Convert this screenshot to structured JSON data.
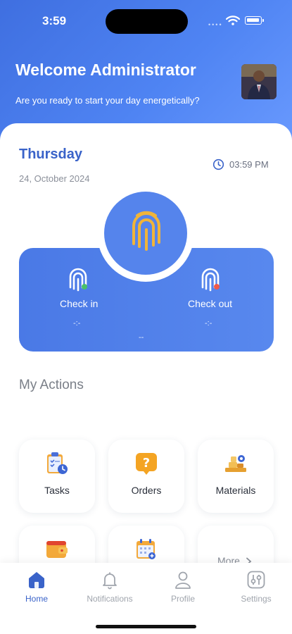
{
  "status_bar": {
    "time": "3:59"
  },
  "header": {
    "welcome": "Welcome Administrator",
    "subtitle": "Are you ready to start your day energetically?"
  },
  "attendance": {
    "day": "Thursday",
    "date": "24, October 2024",
    "current_time": "03:59 PM",
    "check_in": {
      "label": "Check in",
      "value": "-:-"
    },
    "check_out": {
      "label": "Check out",
      "value": "-:-"
    },
    "total": "--"
  },
  "actions": {
    "title": "My Actions",
    "tiles": [
      {
        "label": "Tasks",
        "icon": "tasks-icon"
      },
      {
        "label": "Orders",
        "icon": "orders-icon"
      },
      {
        "label": "Materials",
        "icon": "materials-icon"
      },
      {
        "label": "",
        "icon": "wallet-icon"
      },
      {
        "label": "",
        "icon": "calendar-icon"
      },
      {
        "label": "More",
        "icon": "chevron-right-icon"
      }
    ]
  },
  "nav": {
    "items": [
      {
        "label": "Home",
        "icon": "home-icon",
        "active": true
      },
      {
        "label": "Notifications",
        "icon": "bell-icon",
        "active": false
      },
      {
        "label": "Profile",
        "icon": "user-icon",
        "active": false
      },
      {
        "label": "Settings",
        "icon": "settings-icon",
        "active": false
      }
    ]
  },
  "colors": {
    "accent": "#3a63c9",
    "header": "#4f84f3",
    "fingerprint": "#f0b43a"
  }
}
